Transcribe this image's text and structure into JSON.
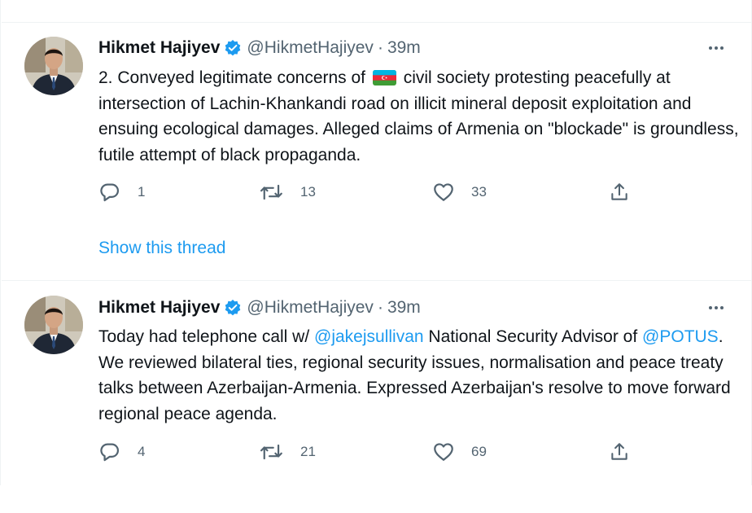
{
  "colors": {
    "link": "#1d9bf0",
    "muted": "#536471",
    "text": "#0f1419",
    "divider": "#eff3f4"
  },
  "tweets": [
    {
      "author_name": "Hikmet Hajiyev",
      "handle": "@HikmetHajiyev",
      "separator": "·",
      "time": "39m",
      "text_start": "2. Conveyed legitimate concerns of ",
      "flag_icon": "azerbaijan-flag-emoji",
      "text_rest": " civil society protesting peacefully at intersection of Lachin-Khankandi road on illicit mineral deposit exploitation and ensuing ecological damages. Alleged claims of Armenia on \"blockade\" is groundless, futile attempt of black propaganda.",
      "replies": "1",
      "retweets": "13",
      "likes": "33",
      "thread_link": "Show this thread"
    },
    {
      "author_name": "Hikmet Hajiyev",
      "handle": "@HikmetHajiyev",
      "separator": "·",
      "time": "39m",
      "text_1": "Today had telephone call w/ ",
      "mention_1": "@jakejsullivan",
      "text_2": " National Security Advisor of ",
      "mention_2": "@POTUS",
      "text_3": ". We reviewed bilateral ties, regional security issues, normalisation and peace treaty talks between Azerbaijan-Armenia. Expressed Azerbaijan's resolve to move forward regional peace agenda.",
      "replies": "4",
      "retweets": "21",
      "likes": "69"
    }
  ]
}
